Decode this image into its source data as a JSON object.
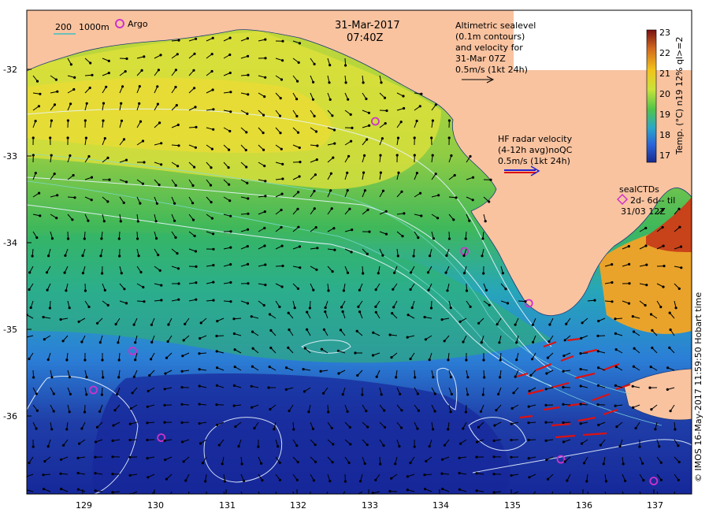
{
  "header": {
    "date": "31-Mar-2017",
    "time": "07:40Z"
  },
  "legend": {
    "depth_200": "200",
    "depth_1000": "1000m",
    "argo": "Argo"
  },
  "altimetry_note": {
    "line1": "Altimetric sealevel",
    "line2": "(0.1m contours)",
    "line3": "and velocity for",
    "line4": "31-Mar 07Z",
    "line5": "0.5m/s (1kt 24h)"
  },
  "hf_radar_note": {
    "line1": "HF radar velocity",
    "line2": "(4-12h avg)noQC",
    "line3": "0.5m/s (1kt 24h)"
  },
  "sealctd_note": {
    "line1": "sealCTDs",
    "line2": "2d- 6d-- til",
    "line3": "31/03 12Z"
  },
  "colorbar": {
    "title": "Temp. (°C) n19 12% ql>=2",
    "ticks": [
      "23",
      "22",
      "21",
      "20",
      "19",
      "18",
      "17"
    ],
    "colors": [
      "#7a1010",
      "#d2691e",
      "#f2c21a",
      "#c8e33a",
      "#4fc44a",
      "#2aa6c8",
      "#2a62d8",
      "#1a2a8c"
    ]
  },
  "axes": {
    "x_ticks": [
      "129",
      "130",
      "131",
      "132",
      "133",
      "134",
      "135",
      "136",
      "137"
    ],
    "y_ticks": [
      "-32",
      "-33",
      "-34",
      "-35",
      "-36"
    ]
  },
  "credit": "© IMOS 16-May-2017 11:59:50 Hobart time",
  "argo_floats": [
    {
      "lon": 133.1,
      "lat": -32.6
    },
    {
      "lon": 134.35,
      "lat": -34.1
    },
    {
      "lon": 135.25,
      "lat": -34.7
    },
    {
      "lon": 129.7,
      "lat": -35.25
    },
    {
      "lon": 129.15,
      "lat": -35.7
    },
    {
      "lon": 130.1,
      "lat": -36.25
    },
    {
      "lon": 135.7,
      "lat": -36.5
    },
    {
      "lon": 137.0,
      "lat": -36.75
    }
  ],
  "colors": {
    "land": "#f9c3a0",
    "argo": "#cc33cc",
    "radar": "#dd1111"
  }
}
